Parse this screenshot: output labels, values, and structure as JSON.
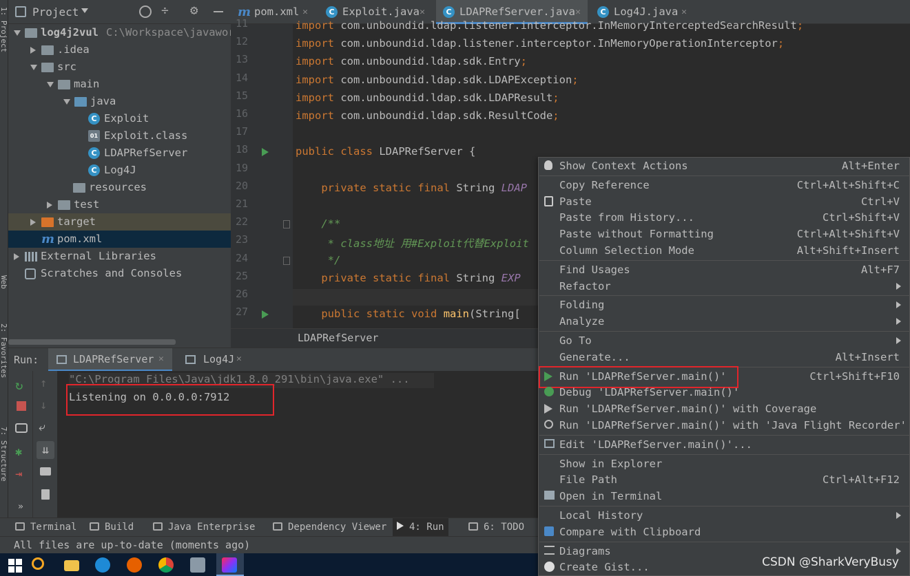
{
  "left_strip": {
    "top_label": "1: Project",
    "mid_label": "Web",
    "fav_label": "2: Favorites",
    "struct_label": "7: Structure"
  },
  "project_panel": {
    "title": "Project",
    "tree": [
      {
        "label": "log4j2vul",
        "extra": "C:\\Workspace\\javawor",
        "kind": "module"
      },
      {
        "label": ".idea",
        "kind": "folder"
      },
      {
        "label": "src",
        "kind": "folder"
      },
      {
        "label": "main",
        "kind": "folder"
      },
      {
        "label": "java",
        "kind": "folder-blue"
      },
      {
        "label": "Exploit",
        "kind": "class"
      },
      {
        "label": "Exploit.class",
        "kind": "classfile"
      },
      {
        "label": "LDAPRefServer",
        "kind": "class-run"
      },
      {
        "label": "Log4J",
        "kind": "class-run"
      },
      {
        "label": "resources",
        "kind": "folder"
      },
      {
        "label": "test",
        "kind": "folder"
      },
      {
        "label": "target",
        "kind": "folder-orange"
      },
      {
        "label": "pom.xml",
        "kind": "maven"
      },
      {
        "label": "External Libraries",
        "kind": "libs"
      },
      {
        "label": "Scratches and Consoles",
        "kind": "scratch"
      }
    ]
  },
  "tabs": [
    {
      "label": "pom.xml",
      "icon": "m"
    },
    {
      "label": "Exploit.java",
      "icon": "C"
    },
    {
      "label": "LDAPRefServer.java",
      "icon": "C",
      "active": true
    },
    {
      "label": "Log4J.java",
      "icon": "C"
    }
  ],
  "editor": {
    "line_numbers": [
      "11",
      "12",
      "13",
      "14",
      "15",
      "16",
      "17",
      "18",
      "19",
      "20",
      "21",
      "22",
      "23",
      "24",
      "25",
      "26",
      "27"
    ],
    "lines": [
      "import com.unboundid.ldap.listener.interceptor.InMemoryInterceptedSearchResult;",
      "import com.unboundid.ldap.listener.interceptor.InMemoryOperationInterceptor;",
      "import com.unboundid.ldap.sdk.Entry;",
      "import com.unboundid.ldap.sdk.LDAPException;",
      "import com.unboundid.ldap.sdk.LDAPResult;",
      "import com.unboundid.ldap.sdk.ResultCode;",
      "",
      "public class LDAPRefServer {",
      "",
      "    private static final String LDAP",
      "",
      "    /**",
      "     * class地址 用#Exploit代替Exploit",
      "     */",
      "    private static final String EXP",
      "",
      "    public static void main(String["
    ],
    "breadcrumb": "LDAPRefServer"
  },
  "run_panel": {
    "label": "Run:",
    "tabs": [
      "LDAPRefServer",
      "Log4J"
    ],
    "console": [
      "\"C:\\Program Files\\Java\\jdk1.8.0_291\\bin\\java.exe\" ...",
      "Listening on 0.0.0.0:7912"
    ]
  },
  "bottom_tools": [
    "Terminal",
    "Build",
    "Java Enterprise",
    "Dependency Viewer",
    "4: Run",
    "6: TODO"
  ],
  "status": "All files are up-to-date (moments ago)",
  "context_menu": [
    {
      "label": "Show Context Actions",
      "shortcut": "Alt+Enter",
      "icon": "bulb-icon"
    },
    {
      "sep": true
    },
    {
      "label": "Copy Reference",
      "shortcut": "Ctrl+Alt+Shift+C"
    },
    {
      "label": "Paste",
      "shortcut": "Ctrl+V",
      "icon": "clipboard-icon"
    },
    {
      "label": "Paste from History...",
      "shortcut": "Ctrl+Shift+V"
    },
    {
      "label": "Paste without Formatting",
      "shortcut": "Ctrl+Alt+Shift+V"
    },
    {
      "label": "Column Selection Mode",
      "shortcut": "Alt+Shift+Insert"
    },
    {
      "sep": true
    },
    {
      "label": "Find Usages",
      "shortcut": "Alt+F7"
    },
    {
      "label": "Refactor",
      "submenu": true
    },
    {
      "sep": true
    },
    {
      "label": "Folding",
      "submenu": true
    },
    {
      "label": "Analyze",
      "submenu": true
    },
    {
      "sep": true
    },
    {
      "label": "Go To",
      "submenu": true
    },
    {
      "label": "Generate...",
      "shortcut": "Alt+Insert"
    },
    {
      "sep": true
    },
    {
      "label": "Run 'LDAPRefServer.main()'",
      "shortcut": "Ctrl+Shift+F10",
      "icon": "run-icon",
      "highlight": true
    },
    {
      "label": "Debug 'LDAPRefServer.main()'",
      "icon": "debug-icon"
    },
    {
      "label": "Run 'LDAPRefServer.main()' with Coverage",
      "icon": "coverage-icon"
    },
    {
      "label": "Run 'LDAPRefServer.main()' with 'Java Flight Recorder'",
      "icon": "profiler-icon"
    },
    {
      "sep": true
    },
    {
      "label": "Edit 'LDAPRefServer.main()'...",
      "icon": "edit-config-icon"
    },
    {
      "sep": true
    },
    {
      "label": "Show in Explorer"
    },
    {
      "label": "File Path",
      "shortcut": "Ctrl+Alt+F12"
    },
    {
      "label": "Open in Terminal",
      "icon": "terminal-icon"
    },
    {
      "sep": true
    },
    {
      "label": "Local History",
      "submenu": true
    },
    {
      "label": "Compare with Clipboard",
      "icon": "compare-icon"
    },
    {
      "sep": true
    },
    {
      "label": "Diagrams",
      "submenu": true,
      "icon": "diagram-icon"
    },
    {
      "label": "Create Gist...",
      "icon": "github-icon"
    }
  ],
  "watermark": "CSDN @SharkVeryBusy",
  "colors": {
    "accent": "#4a88c7",
    "highlight_box": "#e2252b",
    "run_green": "#499c54"
  }
}
